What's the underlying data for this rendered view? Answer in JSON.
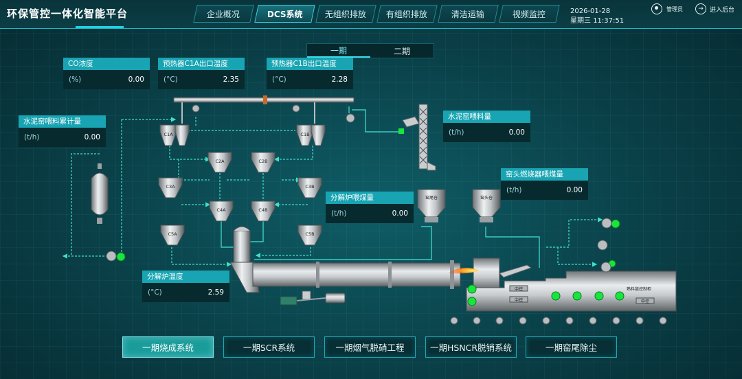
{
  "app": {
    "title": "环保管控一体化智能平台"
  },
  "nav": {
    "tabs": [
      {
        "label": "企业概况",
        "active": false
      },
      {
        "label": "DCS系统",
        "active": true
      },
      {
        "label": "无组织排放",
        "active": false
      },
      {
        "label": "有组织排放",
        "active": false
      },
      {
        "label": "清洁运输",
        "active": false
      },
      {
        "label": "视频监控",
        "active": false
      }
    ]
  },
  "datetime": {
    "date": "2026-01-28",
    "weekday_time": "星期三 11:37:51"
  },
  "user": {
    "name": "管理员",
    "enter_label": "进入后台"
  },
  "phase": {
    "options": [
      "一期",
      "二期"
    ],
    "selected": "一期"
  },
  "cards": {
    "co": {
      "title": "CO浓度",
      "unit": "(%)",
      "value": "0.00"
    },
    "c1a": {
      "title": "预热器C1A出口温度",
      "unit": "(°C)",
      "value": "2.35"
    },
    "c1b": {
      "title": "预热器C1B出口温度",
      "unit": "(°C)",
      "value": "2.28"
    },
    "kiln_feed_total": {
      "title": "水泥窑喂料累计量",
      "unit": "(t/h)",
      "value": "0.00"
    },
    "kiln_feed": {
      "title": "水泥窑喂料量",
      "unit": "(t/h)",
      "value": "0.00"
    },
    "kiln_head_coal": {
      "title": "窑头燃烧器喂煤量",
      "unit": "(t/h)",
      "value": "0.00"
    },
    "calciner_coal": {
      "title": "分解炉喂煤量",
      "unit": "(t/h)",
      "value": "0.00"
    },
    "calciner_temp": {
      "title": "分解炉温度",
      "unit": "(°C)",
      "value": "2.59"
    }
  },
  "diagram": {
    "cyclones": {
      "c1a": "C1A",
      "c1b": "C1B",
      "c2a": "C2A",
      "c2b": "C2B",
      "c3a": "C3A",
      "c3b": "C3B",
      "c4a": "C4A",
      "c4b": "C4B",
      "c5a": "C5A",
      "c5b": "C5B"
    },
    "kiln_tail_bin": "窑尾仓",
    "kiln_head_bin": "窑头仓",
    "cooler_label": "熟料链控制柜",
    "center_labels": [
      "中控",
      "中控",
      "中控"
    ],
    "running_color": "#18e63c"
  },
  "systems": {
    "buttons": [
      {
        "label": "一期烧成系统",
        "active": true
      },
      {
        "label": "一期SCR系统",
        "active": false
      },
      {
        "label": "一期烟气脱硝工程",
        "active": false
      },
      {
        "label": "一期HSNCR脱销系统",
        "active": false
      },
      {
        "label": "一期窑尾除尘",
        "active": false
      }
    ]
  }
}
